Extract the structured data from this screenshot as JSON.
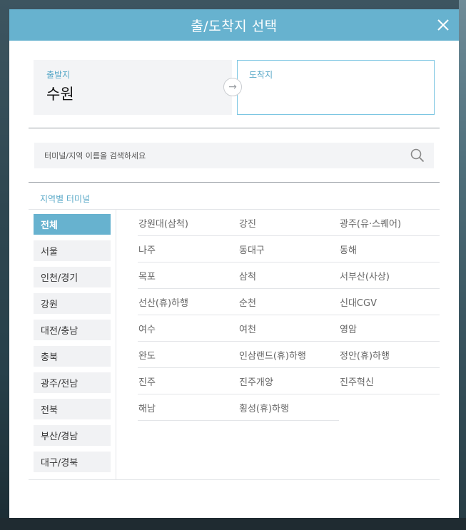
{
  "modal": {
    "title": "출/도착지 선택",
    "close_icon": "close-icon"
  },
  "route": {
    "departure_label": "출발지",
    "departure_value": "수원",
    "swap_icon": "arrow-right-icon",
    "arrival_label": "도착지",
    "arrival_value": ""
  },
  "search": {
    "placeholder": "터미널/지역 이름을 검색하세요",
    "icon": "search-icon"
  },
  "regions": {
    "heading": "지역별 터미널",
    "selected": "전체",
    "items": [
      "전체",
      "서울",
      "인천/경기",
      "강원",
      "대전/충남",
      "충북",
      "광주/전남",
      "전북",
      "부산/경남",
      "대구/경북"
    ]
  },
  "terminals": [
    "강원대(삼척)",
    "강진",
    "광주(유·스퀘어)",
    "나주",
    "동대구",
    "동해",
    "목포",
    "삼척",
    "서부산(사상)",
    "선산(휴)하행",
    "순천",
    "신대CGV",
    "여수",
    "여천",
    "영암",
    "완도",
    "인삼랜드(휴)하행",
    "정안(휴)하행",
    "진주",
    "진주개양",
    "진주혁신",
    "해남",
    "횡성(휴)하행"
  ],
  "colors": {
    "accent": "#67b2cf",
    "label": "#5aa9c8",
    "arrival_border": "#7cc6e2"
  }
}
